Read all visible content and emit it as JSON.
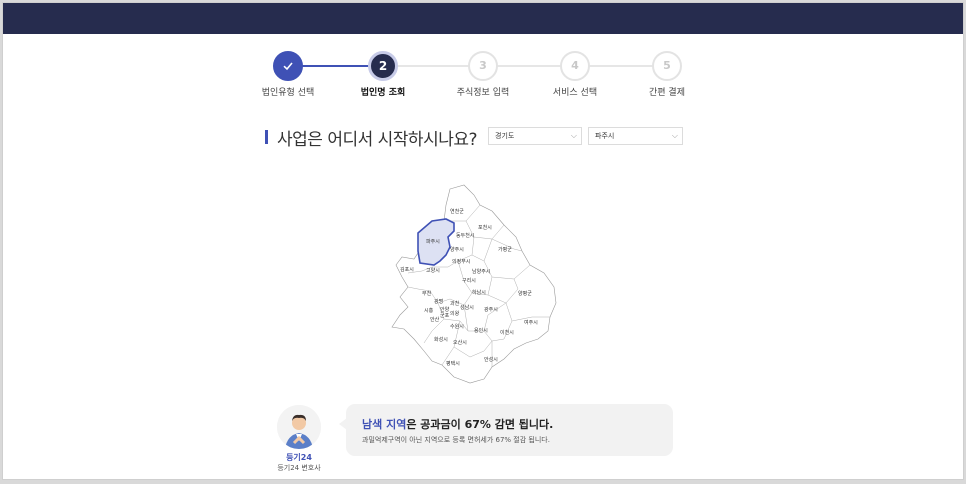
{
  "colors": {
    "header": "#262c4e",
    "accent": "#3f51b5",
    "highlight_fill": "#dde1f3"
  },
  "stepper": {
    "steps": [
      {
        "number": "1",
        "label": "법인유형 선택",
        "state": "done",
        "icon": "check-icon"
      },
      {
        "number": "2",
        "label": "법인명 조회",
        "state": "current"
      },
      {
        "number": "3",
        "label": "주식정보 입력",
        "state": "pending"
      },
      {
        "number": "4",
        "label": "서비스 선택",
        "state": "pending"
      },
      {
        "number": "5",
        "label": "간편 결제",
        "state": "pending"
      }
    ]
  },
  "question": {
    "text": "사업은 어디서 시작하시나요?",
    "province_select": "경기도",
    "city_select": "파주시"
  },
  "map": {
    "selected": "파주시",
    "labels": [
      "연천군",
      "포천시",
      "동두천시",
      "파주시",
      "양주시",
      "가평군",
      "의정부시",
      "김포시",
      "고양시",
      "남양주시",
      "구리시",
      "부천",
      "하남시",
      "양평군",
      "광명",
      "과천",
      "성남시",
      "광주시",
      "시흥",
      "안양",
      "의왕",
      "군포",
      "안산",
      "수원시",
      "여주시",
      "용인시",
      "이천시",
      "화성시",
      "오산시",
      "평택시",
      "안성시"
    ]
  },
  "helper": {
    "avatar_icon": "consultant-avatar-icon",
    "name": "등기24",
    "role": "등기24 변호사"
  },
  "bubble": {
    "title_highlight": "남색 지역",
    "title_rest": "은 공과금이 67% 감면 됩니다.",
    "description": "과밀억제구역이 아닌 지역으로 등록 면허세가 67% 절감 됩니다."
  }
}
